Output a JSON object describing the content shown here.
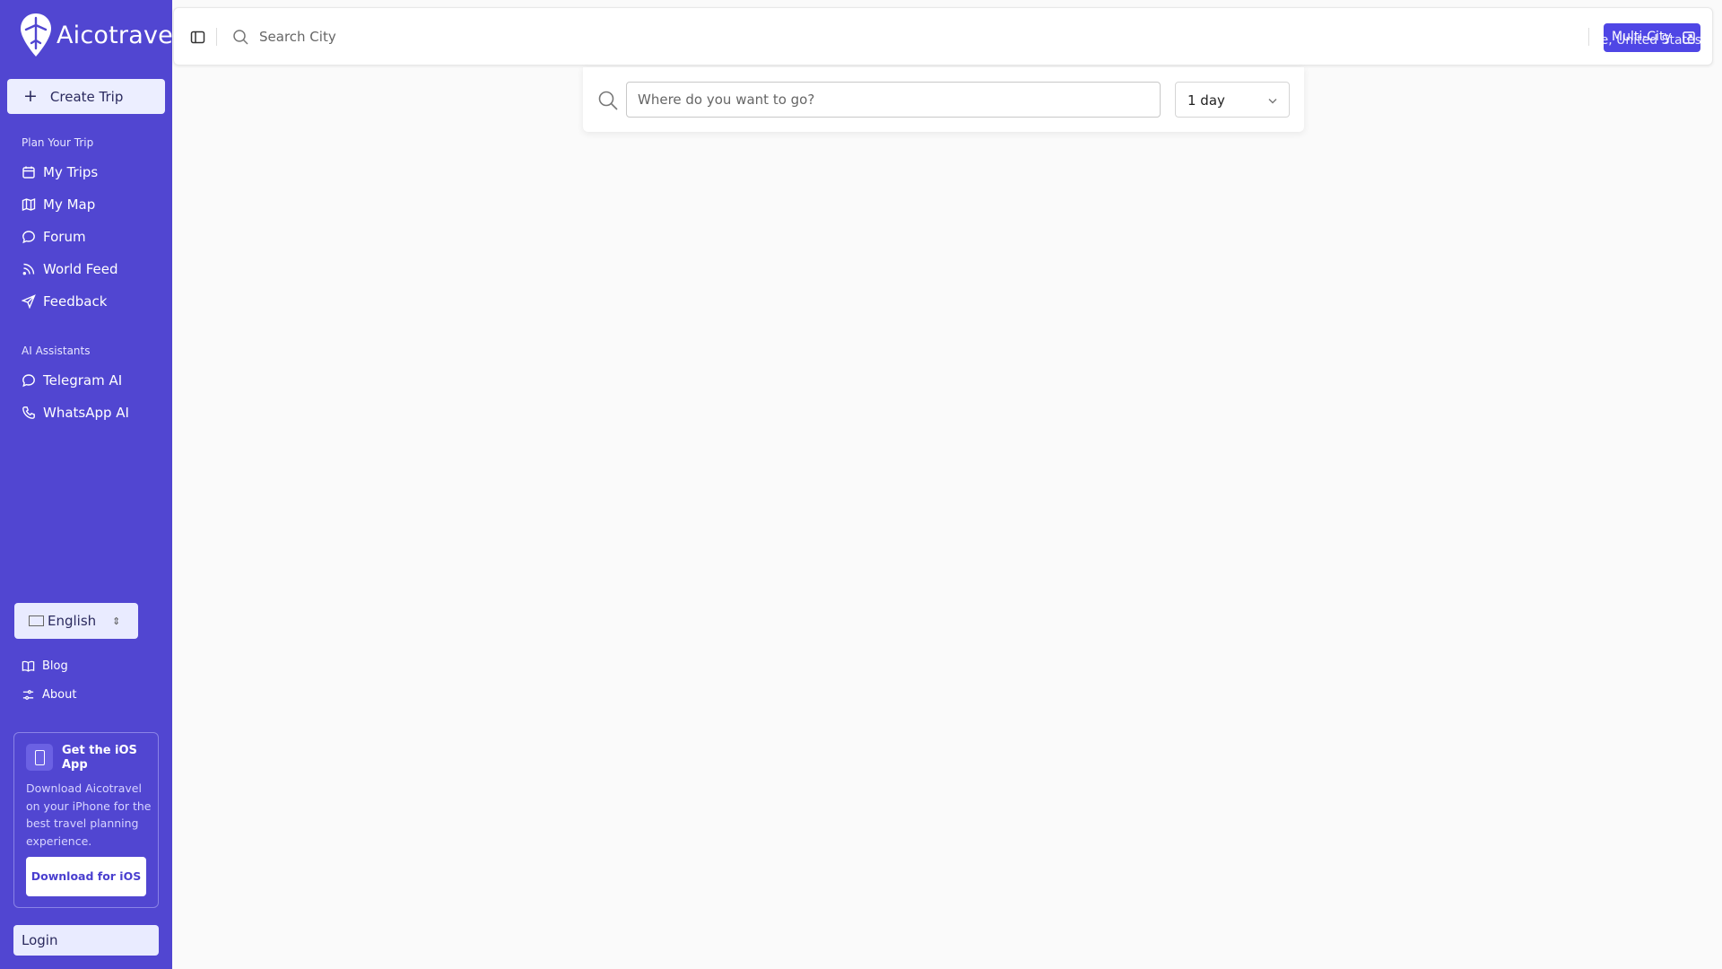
{
  "app": {
    "name": "Aicotrave"
  },
  "sidebar": {
    "create_trip": "Create Trip",
    "plan_section": "Plan Your Trip",
    "plan_items": [
      {
        "label": "My Trips",
        "icon": "calendar-icon"
      },
      {
        "label": "My Map",
        "icon": "map-icon"
      },
      {
        "label": "Forum",
        "icon": "chat-bubble-icon"
      },
      {
        "label": "World Feed",
        "icon": "rss-icon"
      },
      {
        "label": "Feedback",
        "icon": "send-icon"
      }
    ],
    "ai_section": "AI Assistants",
    "ai_items": [
      {
        "label": "Telegram AI",
        "icon": "chat-bubble-icon"
      },
      {
        "label": "WhatsApp AI",
        "icon": "phone-icon"
      }
    ],
    "language": {
      "flag": "flag-icon",
      "label": "English"
    },
    "footer_links": [
      {
        "label": "Blog",
        "icon": "book-icon"
      },
      {
        "label": "About",
        "icon": "sliders-icon"
      }
    ],
    "ios_card": {
      "title": "Get the iOS App",
      "description": "Download Aicotravel on your iPhone for the best travel planning experience.",
      "button": "Download for iOS"
    },
    "login": "Login"
  },
  "topbar": {
    "search_placeholder": "Search City",
    "multicity_label": "Multi-City",
    "location_text": "e, United States"
  },
  "main": {
    "destination_placeholder": "Where do you want to go?",
    "duration_value": "1 day"
  },
  "colors": {
    "sidebar_bg": "#5146d1",
    "accent": "#4f46e5",
    "page_bg": "#fafafa"
  }
}
